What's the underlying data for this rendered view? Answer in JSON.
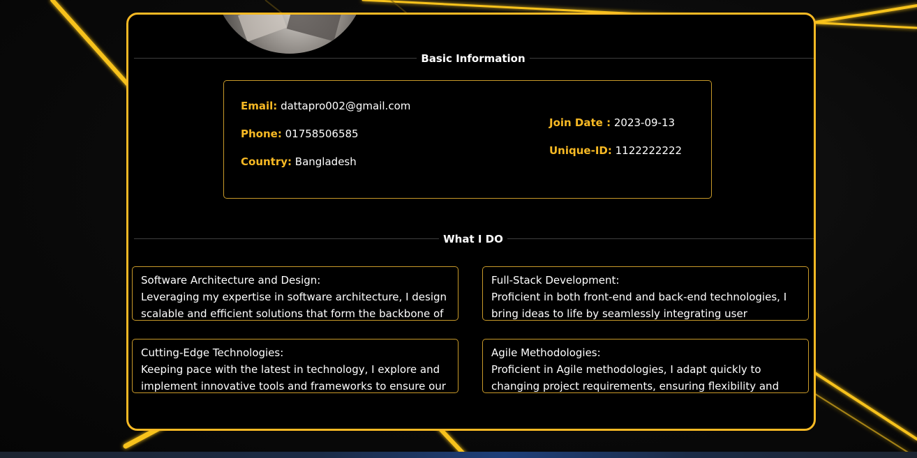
{
  "basic": {
    "title": "Basic Information",
    "email": {
      "label": "Email:",
      "value": "dattapro002@gmail.com"
    },
    "phone": {
      "label": "Phone:",
      "value": "01758506585"
    },
    "country": {
      "label": "Country:",
      "value": "Bangladesh"
    },
    "join_date": {
      "label": "Join Date :",
      "value": "2023-09-13"
    },
    "unique_id": {
      "label": "Unique-ID:",
      "value": "1122222222"
    }
  },
  "whatido": {
    "title": "What I DO",
    "items": [
      {
        "title": "Software Architecture and Design:",
        "desc": "Leveraging my expertise in software architecture, I design scalable and efficient solutions that form the backbone of"
      },
      {
        "title": "Full-Stack Development:",
        "desc": "Proficient in both front-end and back-end technologies, I bring ideas to life by seamlessly integrating user interfaces with"
      },
      {
        "title": "Cutting-Edge Technologies:",
        "desc": "Keeping pace with the latest in technology, I explore and implement innovative tools and frameworks to ensure our"
      },
      {
        "title": "Agile Methodologies:",
        "desc": "Proficient in Agile methodologies, I adapt quickly to changing project requirements, ensuring flexibility and responsiveness in"
      }
    ]
  },
  "colors": {
    "accent": "#f7b924",
    "background": "#000000",
    "text": "#ffffff"
  }
}
